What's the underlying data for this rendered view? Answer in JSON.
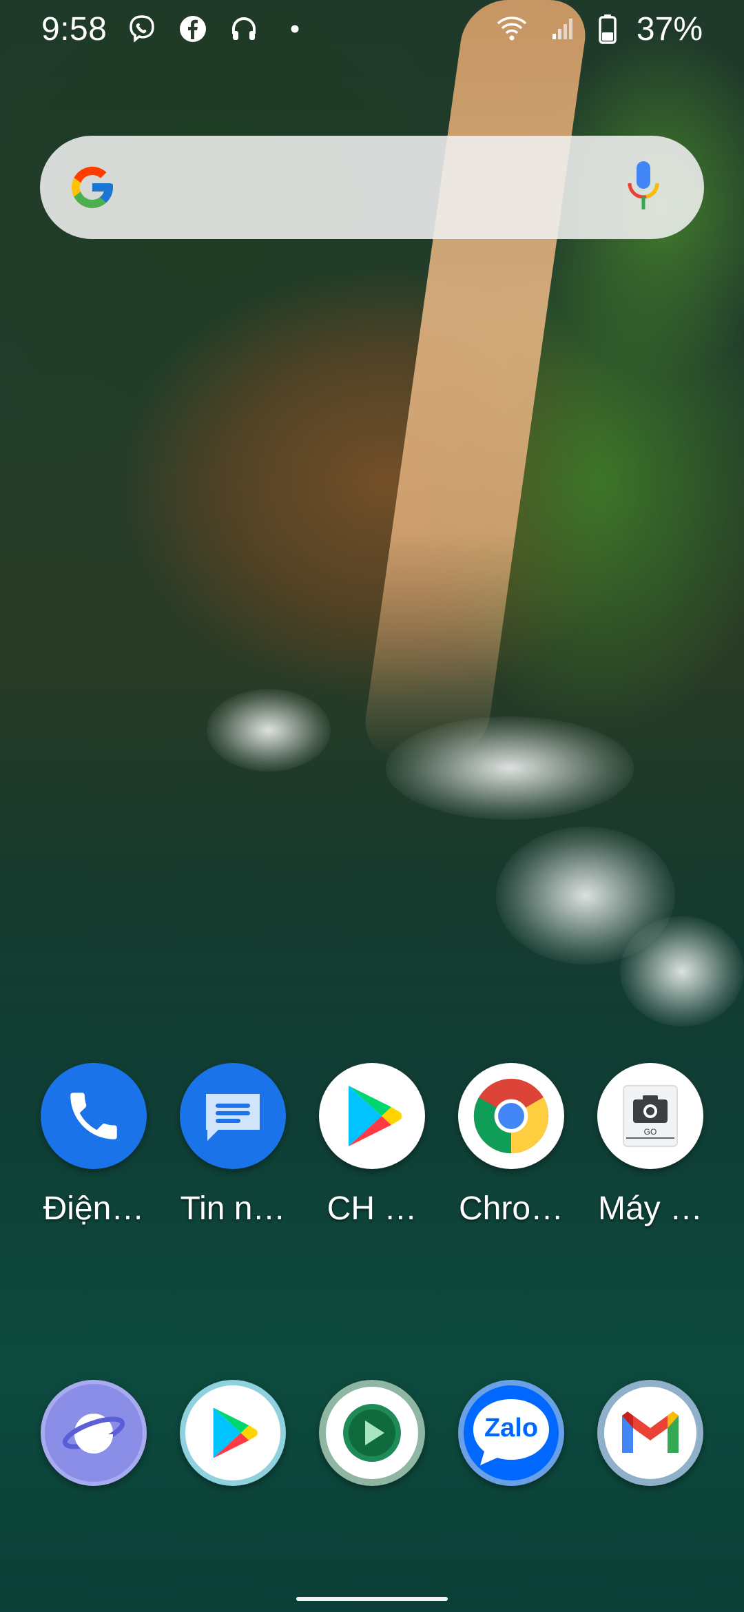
{
  "status_bar": {
    "time": "9:58",
    "notification_icons": [
      "viber-icon",
      "facebook-icon",
      "headphones-icon",
      "dot-icon"
    ],
    "system_icons": [
      "wifi-icon",
      "signal-icon",
      "battery-icon"
    ],
    "battery": "37%"
  },
  "search": {
    "logo": "google-g-icon",
    "mic": "mic-icon"
  },
  "home_apps": [
    {
      "label": "Điện…",
      "icon": "phone-icon",
      "color": "#1a73e8"
    },
    {
      "label": "Tin n…",
      "icon": "messages-icon",
      "color": "#1a73e8"
    },
    {
      "label": "CH …",
      "icon": "play-store-icon",
      "color": "#ffffff"
    },
    {
      "label": "Chro…",
      "icon": "chrome-icon",
      "color": "#ffffff"
    },
    {
      "label": "Máy …",
      "icon": "camera-go-icon",
      "color": "#ffffff"
    }
  ],
  "dock_apps": [
    {
      "icon": "samsung-internet-icon"
    },
    {
      "icon": "play-store-icon"
    },
    {
      "icon": "video-player-icon"
    },
    {
      "icon": "zalo-icon",
      "text": "Zalo"
    },
    {
      "icon": "gmail-icon"
    }
  ],
  "camera_badge": "GO"
}
